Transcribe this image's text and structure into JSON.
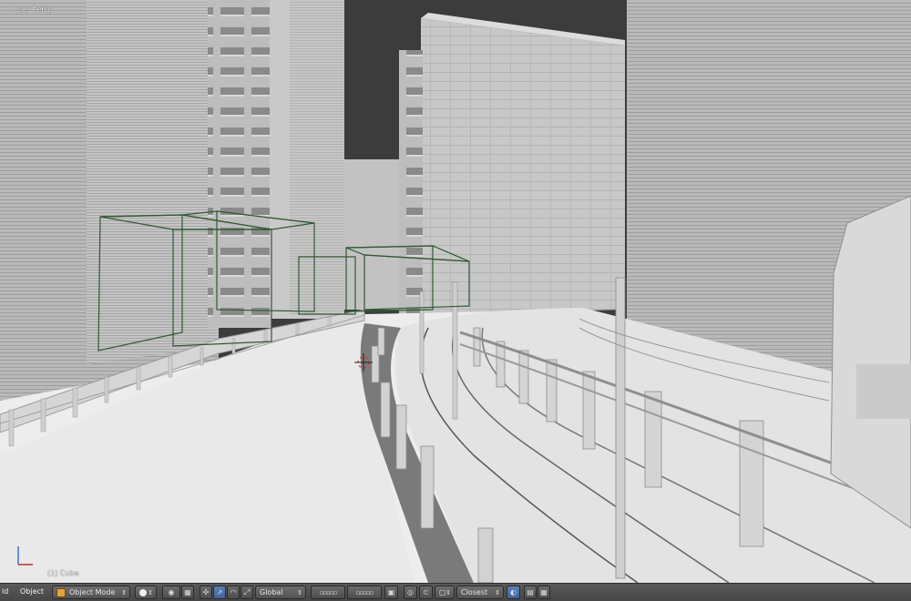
{
  "viewport": {
    "view_label": "User Persp",
    "object_label": "(1) Cube"
  },
  "header": {
    "menu_view": "ld",
    "menu_object": "Object",
    "mode": "Object Mode",
    "orientation": "Global",
    "snap_target": "Closest"
  },
  "icons": {
    "mode": "object-cube-icon",
    "shading": "solid-sphere-icon",
    "pivot": "pivot-point-icon",
    "manipulator": "manipulator-icon",
    "layers": "layer-grid-icon",
    "snap": "snap-magnet-icon",
    "render": "render-icon"
  },
  "colors": {
    "header_bg": "#4d4d4d",
    "active_blue": "#5680c2",
    "wire_green": "#2f5a2f"
  }
}
